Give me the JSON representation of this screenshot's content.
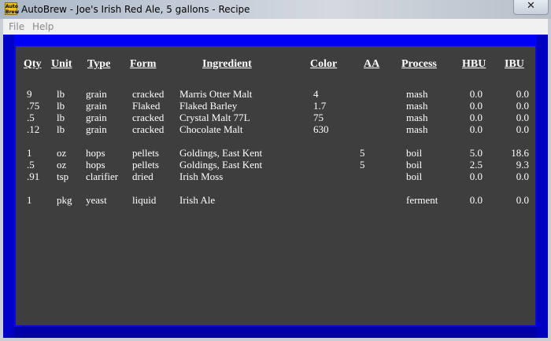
{
  "window": {
    "title": "AutoBrew - Joe's Irish Red Ale, 5 gallons - Recipe",
    "icon_text": "Auto Brew",
    "close_glyph": "✕"
  },
  "menu": [
    "File",
    "Help"
  ],
  "columns": [
    "Qty",
    "Unit",
    "Type",
    "Form",
    "Ingredient",
    "Color",
    "AA",
    "Process",
    "HBU",
    "IBU"
  ],
  "rows": [
    {
      "qty": "9",
      "unit": "lb",
      "type": "grain",
      "form": "cracked",
      "ingredient": "Marris Otter Malt",
      "color": "4",
      "aa": "",
      "process": "mash",
      "hbu": "0.0",
      "ibu": "0.0"
    },
    {
      "qty": ".75",
      "unit": "lb",
      "type": "grain",
      "form": "Flaked",
      "ingredient": "Flaked Barley",
      "color": "1.7",
      "aa": "",
      "process": "mash",
      "hbu": "0.0",
      "ibu": "0.0"
    },
    {
      "qty": ".5",
      "unit": "lb",
      "type": "grain",
      "form": "cracked",
      "ingredient": "Crystal Malt 77L",
      "color": "75",
      "aa": "",
      "process": "mash",
      "hbu": "0.0",
      "ibu": "0.0"
    },
    {
      "qty": ".12",
      "unit": "lb",
      "type": "grain",
      "form": "cracked",
      "ingredient": "Chocolate Malt",
      "color": "630",
      "aa": "",
      "process": "mash",
      "hbu": "0.0",
      "ibu": "0.0"
    },
    {
      "qty": "1",
      "unit": "oz",
      "type": "hops",
      "form": "pellets",
      "ingredient": "Goldings, East Kent",
      "color": "",
      "aa": "5",
      "process": "boil",
      "hbu": "5.0",
      "ibu": "18.6"
    },
    {
      "qty": ".5",
      "unit": "oz",
      "type": "hops",
      "form": "pellets",
      "ingredient": "Goldings, East Kent",
      "color": "",
      "aa": "5",
      "process": "boil",
      "hbu": "2.5",
      "ibu": "9.3"
    },
    {
      "qty": ".91",
      "unit": "tsp",
      "type": "clarifier",
      "form": "dried",
      "ingredient": "Irish Moss",
      "color": "",
      "aa": "",
      "process": "boil",
      "hbu": "0.0",
      "ibu": "0.0"
    },
    {
      "qty": "1",
      "unit": "pkg",
      "type": "yeast",
      "form": "liquid",
      "ingredient": "Irish Ale",
      "color": "",
      "aa": "",
      "process": "ferment",
      "hbu": "0.0",
      "ibu": "0.0"
    }
  ]
}
